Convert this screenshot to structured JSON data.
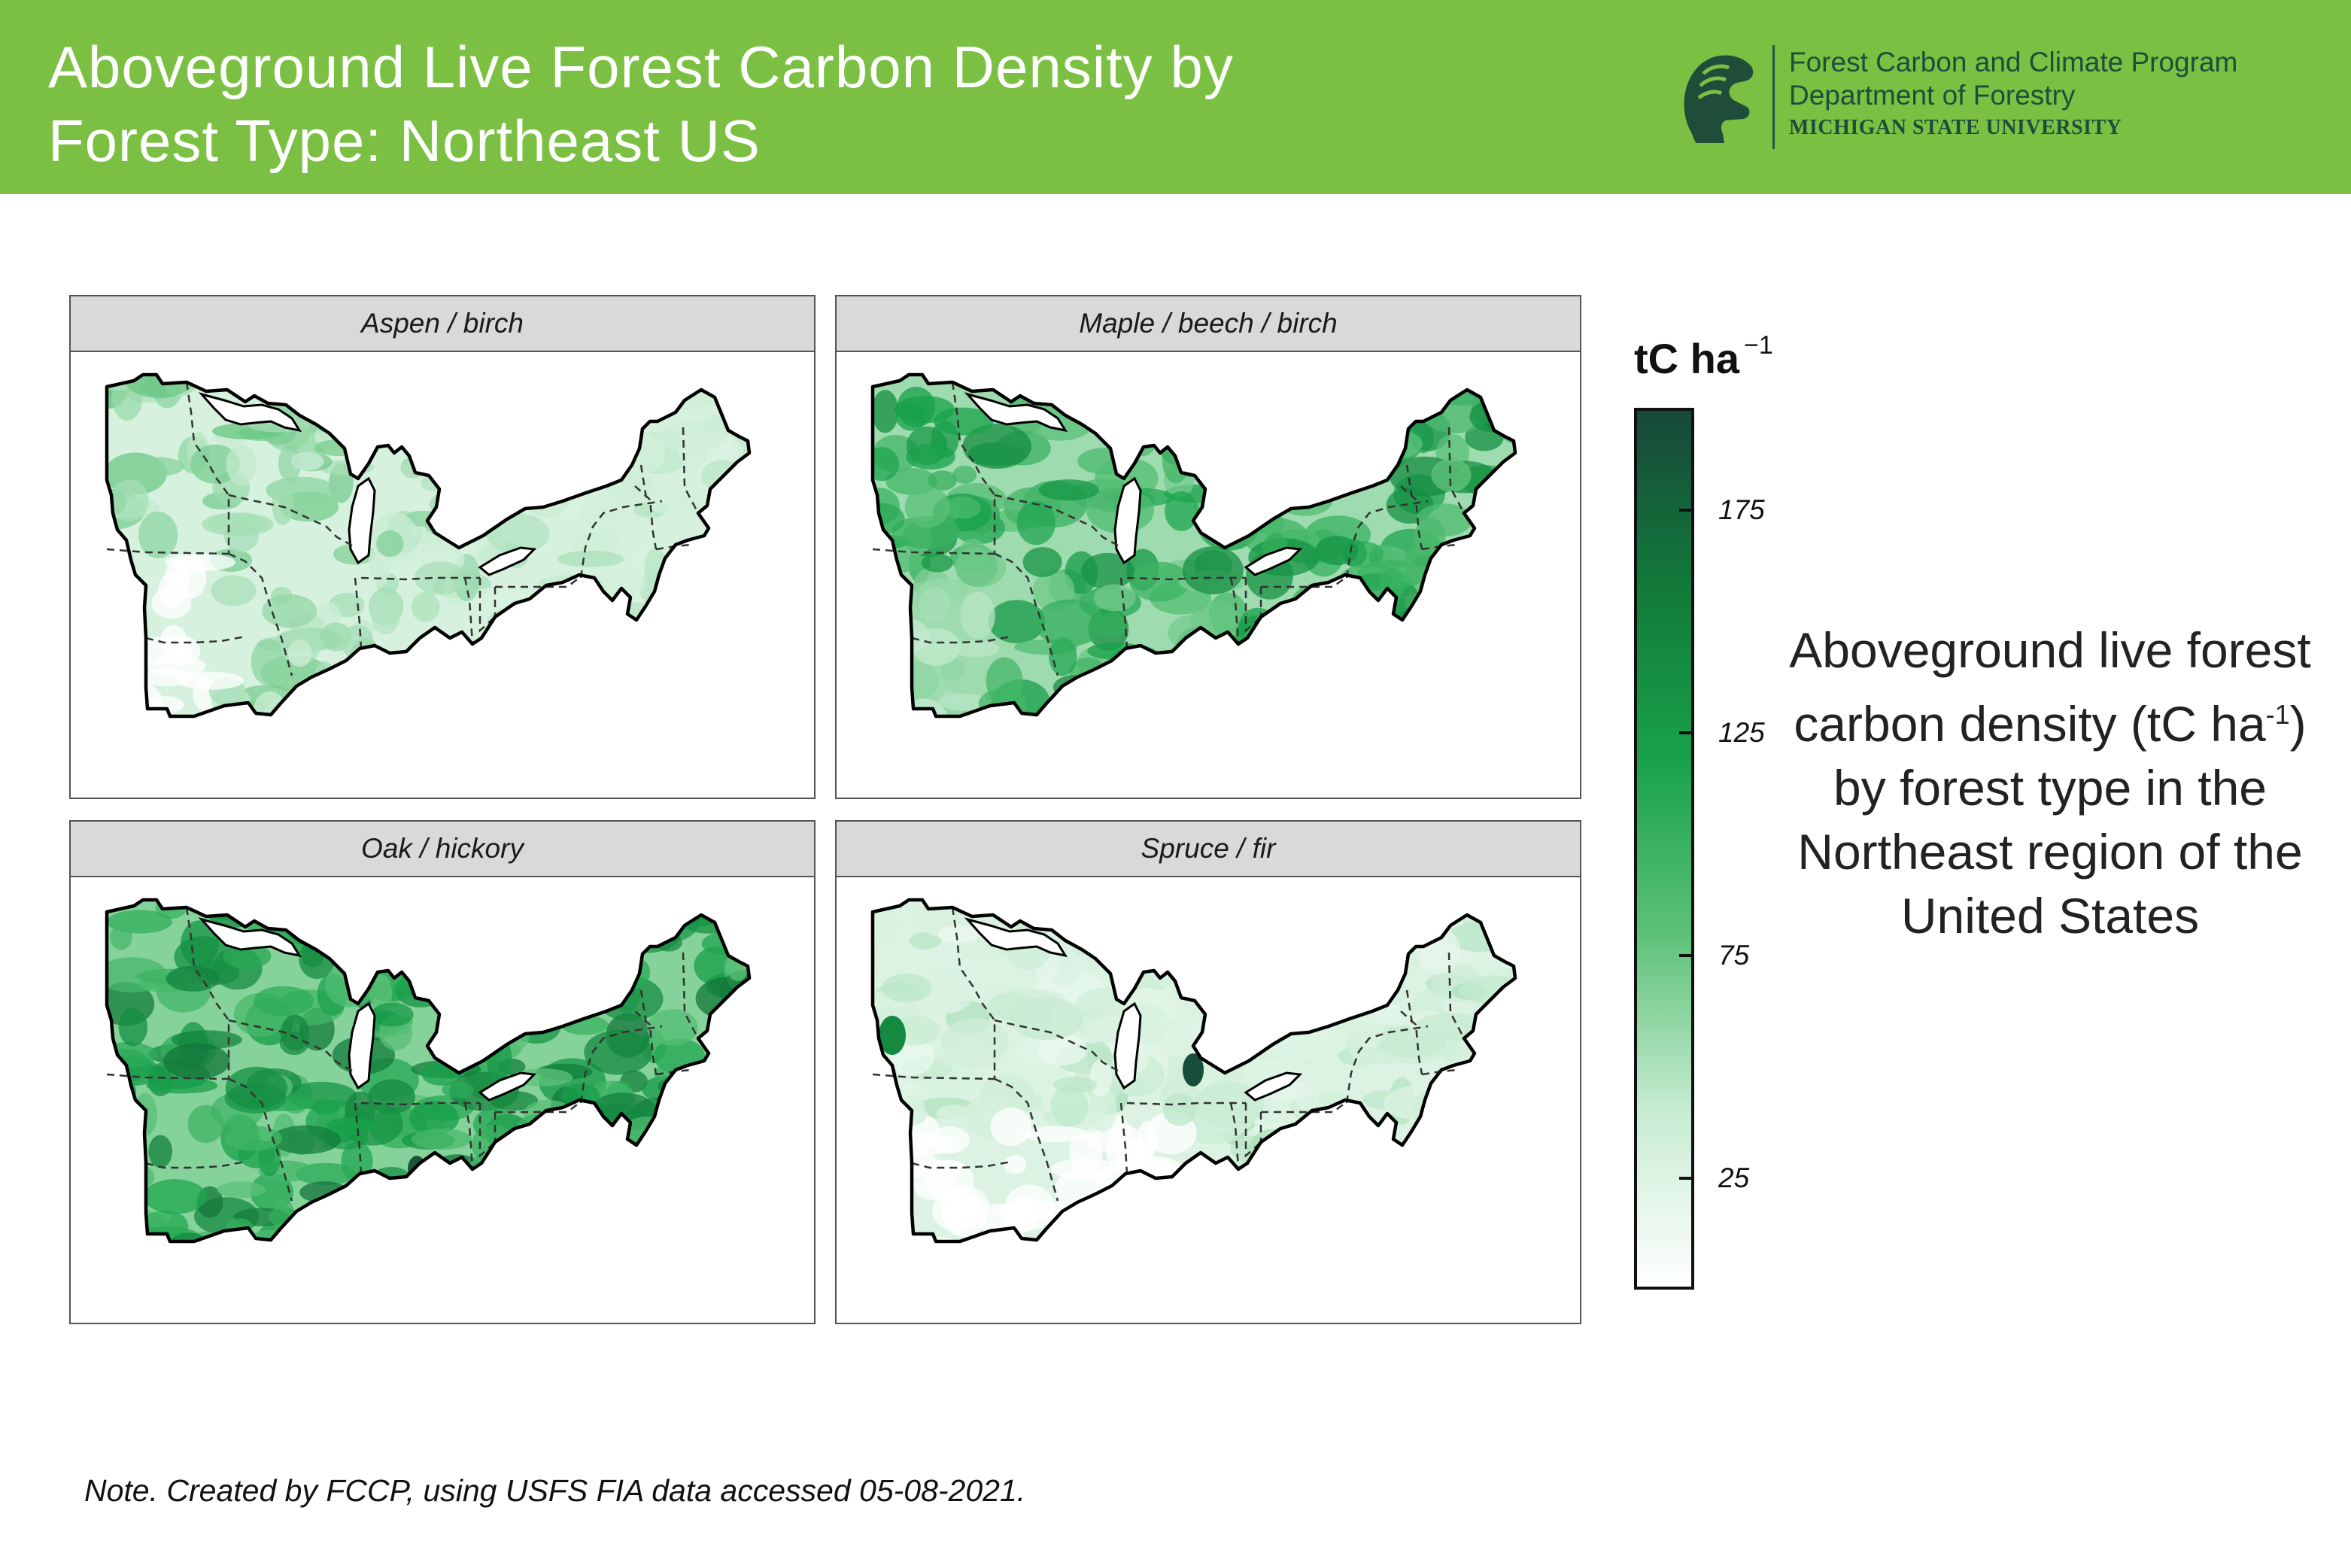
{
  "header": {
    "title_line1": "Aboveground Live Forest Carbon Density by",
    "title_line2": "Forest Type: Northeast US",
    "background_color": "#7bc043"
  },
  "logo": {
    "icon": "spartan-helmet-icon",
    "line1": "Forest Carbon and Climate Program",
    "line2": "Department of Forestry",
    "line3": "MICHIGAN STATE UNIVERSITY",
    "color": "#1f4d3a"
  },
  "panels": [
    {
      "label": "Aspen / birch",
      "intensity": 0.32,
      "hotspot": "none"
    },
    {
      "label": "Maple / beech / birch",
      "intensity": 0.62,
      "hotspot": "none"
    },
    {
      "label": "Oak / hickory",
      "intensity": 0.72,
      "hotspot": "dark"
    },
    {
      "label": "Spruce / fir",
      "intensity": 0.28,
      "hotspot": "dark"
    }
  ],
  "legend": {
    "title": "tC ha",
    "superscript": "−1",
    "ticks": [
      "175",
      "125",
      "75",
      "25"
    ],
    "tick_values": [
      175,
      125,
      75,
      25
    ],
    "range": [
      0,
      198
    ],
    "colors": [
      "#ffffff",
      "#c8ecd2",
      "#5ec27a",
      "#18a24a",
      "#127a3a",
      "#17483a"
    ]
  },
  "description": {
    "text": "Aboveground live forest carbon density (tC ha",
    "superscript": "-1",
    "text_after": ") by forest type in the Northeast region of the United States"
  },
  "note": "Note. Created by FCCP, using USFS FIA data accessed 05-08-2021."
}
